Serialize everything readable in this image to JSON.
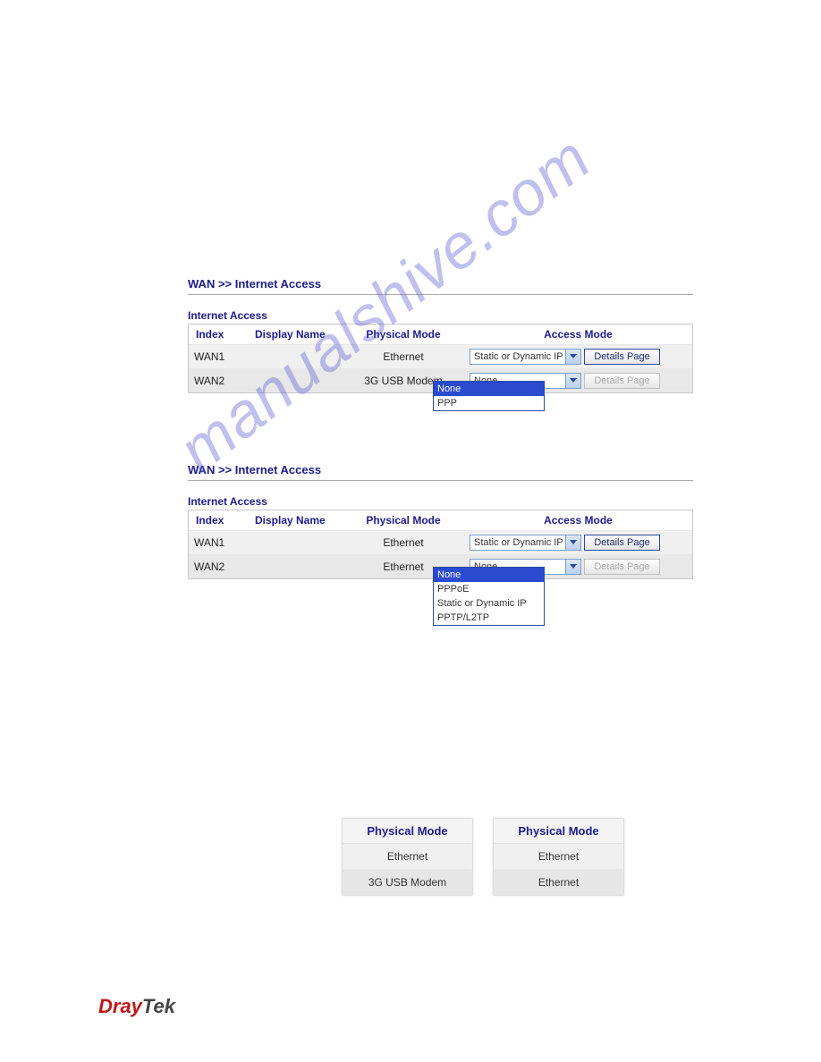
{
  "watermark": "manualshive.com",
  "logo": {
    "brand1": "Dray",
    "brand2": "Tek"
  },
  "panel1": {
    "breadcrumb": "WAN >> Internet Access",
    "title": "Internet Access",
    "headers": {
      "index": "Index",
      "display": "Display Name",
      "physical": "Physical Mode",
      "access": "Access Mode"
    },
    "rows": [
      {
        "index": "WAN1",
        "display": "",
        "physical": "Ethernet",
        "mode": "Static or Dynamic IP",
        "btn": "Details Page",
        "btn_enabled": true
      },
      {
        "index": "WAN2",
        "display": "",
        "physical": "3G USB Modem",
        "mode": "None",
        "btn": "Details Page",
        "btn_enabled": false
      }
    ],
    "dropdown": {
      "options": [
        "None",
        "PPP"
      ],
      "selected": "None"
    }
  },
  "panel2": {
    "breadcrumb": "WAN >> Internet Access",
    "title": "Internet Access",
    "headers": {
      "index": "Index",
      "display": "Display Name",
      "physical": "Physical Mode",
      "access": "Access Mode"
    },
    "rows": [
      {
        "index": "WAN1",
        "display": "",
        "physical": "Ethernet",
        "mode": "Static or Dynamic IP",
        "btn": "Details Page",
        "btn_enabled": true
      },
      {
        "index": "WAN2",
        "display": "",
        "physical": "Ethernet",
        "mode": "None",
        "btn": "Details Page",
        "btn_enabled": false
      }
    ],
    "dropdown": {
      "options": [
        "None",
        "PPPoE",
        "Static or Dynamic IP",
        "PPTP/L2TP"
      ],
      "selected": "None"
    }
  },
  "mini": {
    "header": "Physical Mode",
    "left": [
      "Ethernet",
      "3G USB Modem"
    ],
    "right": [
      "Ethernet",
      "Ethernet"
    ]
  }
}
